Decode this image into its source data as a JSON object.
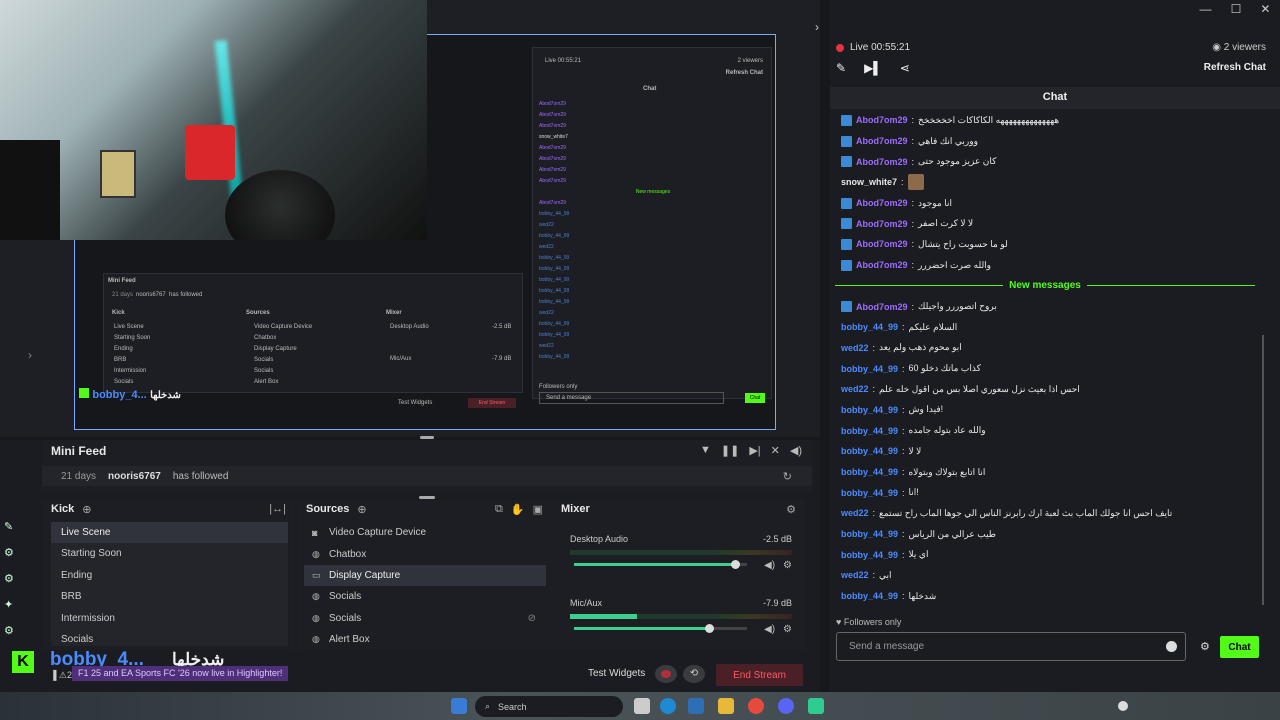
{
  "window": {
    "minimize": "—",
    "maximize": "☐",
    "close": "✕"
  },
  "preview": {
    "capture": {
      "live_time": "Live 00:55:21",
      "viewers": "2 viewers",
      "refresh": "Refresh Chat",
      "chat_title": "Chat",
      "new_messages": "New messages",
      "followers_only": "Followers only",
      "send_placeholder": "Send a message",
      "chat_btn": "Chat",
      "mini_feed": "Mini Feed",
      "mf_days": "21 days",
      "mf_user": "nooris6767",
      "mf_action": "has followed",
      "kick": "Kick",
      "sources": "Sources",
      "mixer": "Mixer",
      "scenes": [
        "Live Scene",
        "Starting Soon",
        "Ending",
        "BRB",
        "Intermission",
        "Socials"
      ],
      "source_items": [
        "Video Capture Device",
        "Chatbox",
        "Display Capture",
        "Socials",
        "Socials",
        "Alert Box"
      ],
      "desktop_audio": "Desktop Audio",
      "desktop_db": "-2.5 dB",
      "mic": "Mic/Aux",
      "mic_db": "-7.9 dB",
      "test_widgets": "Test Widgets",
      "end_stream": "End Stream",
      "overlay_name": "bobby_4...",
      "overlay_title": "شدخلها"
    }
  },
  "minifeed": {
    "title": "Mini Feed",
    "days": "21 days",
    "user": "nooris6767",
    "action": "has followed"
  },
  "scenes": {
    "title": "Kick",
    "items": [
      "Live Scene",
      "Starting Soon",
      "Ending",
      "BRB",
      "Intermission",
      "Socials"
    ],
    "active": 0
  },
  "sources": {
    "title": "Sources",
    "items": [
      {
        "label": "Video Capture Device",
        "icon": "camera-icon"
      },
      {
        "label": "Chatbox",
        "icon": "browser-icon"
      },
      {
        "label": "Display Capture",
        "icon": "monitor-icon"
      },
      {
        "label": "Socials",
        "icon": "browser-icon"
      },
      {
        "label": "Socials",
        "icon": "browser-icon"
      },
      {
        "label": "Alert Box",
        "icon": "browser-icon"
      }
    ],
    "active": 2
  },
  "mixer": {
    "title": "Mixer",
    "channels": [
      {
        "name": "Desktop Audio",
        "db": "-2.5 dB",
        "level": 0.0,
        "volume": 0.93
      },
      {
        "name": "Mic/Aux",
        "db": "-7.9 dB",
        "level": 0.3,
        "volume": 0.78
      }
    ]
  },
  "footer": {
    "test_widgets": "Test Widgets",
    "end_stream": "End Stream"
  },
  "overlay": {
    "kick_letter": "K",
    "name": "bobby_4...",
    "title": "شدخلها",
    "banner": "F1 25 and EA Sports FC '26 now live in Highlighter!",
    "badge_count": "2"
  },
  "taskbar": {
    "search_placeholder": "Search"
  },
  "chat": {
    "live_time": "Live 00:55:21",
    "viewers": "2 viewers",
    "refresh": "Refresh Chat",
    "title": "Chat",
    "new_messages_label": "New messages",
    "messages_before": [
      {
        "user": "Abod7om29",
        "text": "ههههههههههههههه الكاكاكات اخخخخخخ",
        "color": "#9d6cff",
        "badge": true
      },
      {
        "user": "Abod7om29",
        "text": "ووربي انك فاهي",
        "color": "#9d6cff",
        "badge": true
      },
      {
        "user": "Abod7om29",
        "text": "كان عزيز موجود حتى",
        "color": "#9d6cff",
        "badge": true
      },
      {
        "user": "snow_white7",
        "text": "",
        "color": "#e8e8e8",
        "badge": false,
        "emote": true
      },
      {
        "user": "Abod7om29",
        "text": "انا موجود",
        "color": "#9d6cff",
        "badge": true
      },
      {
        "user": "Abod7om29",
        "text": "لا لا كرت اصفر",
        "color": "#9d6cff",
        "badge": true
      },
      {
        "user": "Abod7om29",
        "text": "لو ما حسوبت راح يتشال",
        "color": "#9d6cff",
        "badge": true
      },
      {
        "user": "Abod7om29",
        "text": "والله صرت احضررر",
        "color": "#9d6cff",
        "badge": true
      }
    ],
    "messages_after": [
      {
        "user": "Abod7om29",
        "text": "بروح اتصوررر واجيلك",
        "color": "#9d6cff",
        "badge": true
      },
      {
        "user": "bobby_44_99",
        "text": "السلام عليكم",
        "color": "#4a8bff",
        "badge": false
      },
      {
        "user": "wed22",
        "text": "ابو محوم ذهب ولم يعد",
        "color": "#4a8bff",
        "badge": false
      },
      {
        "user": "bobby_44_99",
        "text": "كذاب ماتك دخلو 60",
        "color": "#4a8bff",
        "badge": false
      },
      {
        "user": "wed22",
        "text": "احس اذا بعيث نزل سعوري اصلا بس من اقول خله علم",
        "color": "#4a8bff",
        "badge": false
      },
      {
        "user": "bobby_44_99",
        "text": "فيدا وش!",
        "color": "#4a8bff",
        "badge": false
      },
      {
        "user": "bobby_44_99",
        "text": "والله عاد بتوله جامده",
        "color": "#4a8bff",
        "badge": false
      },
      {
        "user": "bobby_44_99",
        "text": "لا لا",
        "color": "#4a8bff",
        "badge": false
      },
      {
        "user": "bobby_44_99",
        "text": "انا اتابع بتولاك وبتولاه",
        "color": "#4a8bff",
        "badge": false
      },
      {
        "user": "bobby_44_99",
        "text": "انا!",
        "color": "#4a8bff",
        "badge": false
      },
      {
        "user": "wed22",
        "text": "تايف احس انا جولك الماب بث لعبة ارك رابرنز الناس الي جوها الماب راح تستمع",
        "color": "#4a8bff",
        "badge": false
      },
      {
        "user": "bobby_44_99",
        "text": "طيب عرالي من الرياس",
        "color": "#4a8bff",
        "badge": false
      },
      {
        "user": "bobby_44_99",
        "text": "اي يلا",
        "color": "#4a8bff",
        "badge": false
      },
      {
        "user": "wed22",
        "text": "ابي",
        "color": "#4a8bff",
        "badge": false
      },
      {
        "user": "bobby_44_99",
        "text": "شدخلها",
        "color": "#4a8bff",
        "badge": false
      }
    ],
    "followers_only": "Followers only",
    "input_placeholder": "Send a message",
    "send_label": "Chat"
  },
  "colors": {
    "kick_green": "#53fc18",
    "live_red": "#e5343f",
    "end_stream_red": "#ff5a66",
    "panel_bg": "#1d1e23"
  }
}
